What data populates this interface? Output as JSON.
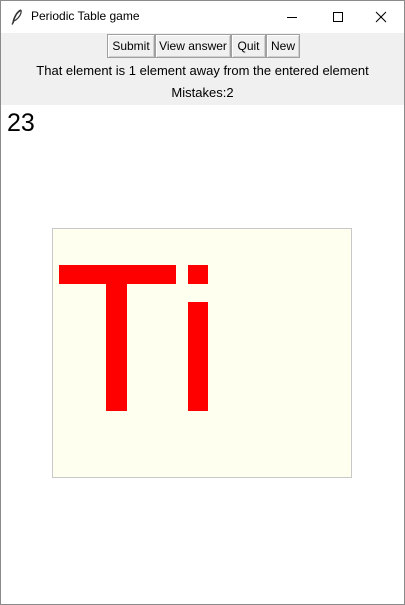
{
  "window": {
    "title": "Periodic Table game"
  },
  "toolbar": {
    "submit_label": "Submit",
    "view_answer_label": "View answer",
    "quit_label": "Quit",
    "new_label": "New"
  },
  "status": {
    "hint": "That element is 1 element away from the entered element",
    "mistakes": "Mistakes:2"
  },
  "element": {
    "atomic_number": "23",
    "symbol": "Ti",
    "symbol_color": "#ff0000",
    "canvas_bg": "#fffff0"
  },
  "icons": {
    "app": "feather-icon",
    "minimize": "minimize-icon",
    "maximize": "maximize-icon",
    "close": "close-icon"
  }
}
